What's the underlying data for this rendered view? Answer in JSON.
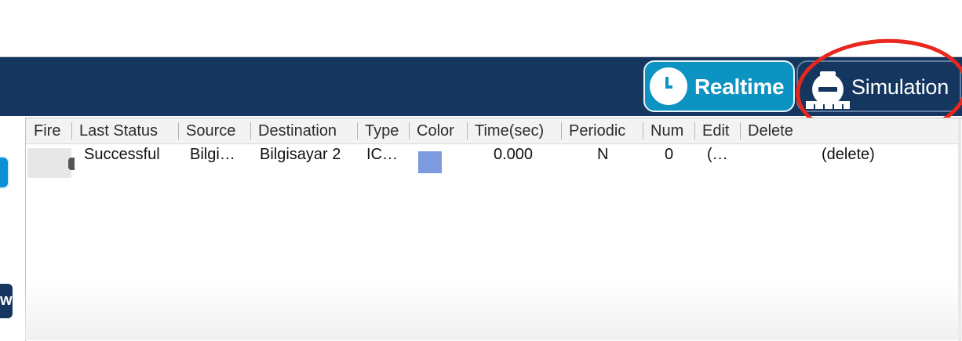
{
  "mode_toolbar": {
    "realtime_label": "Realtime",
    "simulation_label": "Simulation",
    "realtime_icon": "clock-icon",
    "simulation_icon": "stopwatch-icon",
    "colors": {
      "bar": "#14365f",
      "realtime_bg": "#0d93c2"
    }
  },
  "left_toolbar": {
    "partial_button_text": "w"
  },
  "pdu_table": {
    "columns": [
      "Fire",
      "Last Status",
      "Source",
      "Destination",
      "Type",
      "Color",
      "Time(sec)",
      "Periodic",
      "Num",
      "Edit",
      "Delete"
    ],
    "rows": [
      {
        "last_status": "Successful",
        "source": "Bilgi…",
        "destination": "Bilgisayar 2",
        "type": "IC…",
        "color": "#7f9be0",
        "time_sec": "0.000",
        "periodic": "N",
        "num": "0",
        "edit": "(…",
        "delete": "(delete)"
      }
    ]
  },
  "annotation": {
    "color": "#e8281e",
    "shape": "ellipse",
    "target": "simulation-button"
  }
}
